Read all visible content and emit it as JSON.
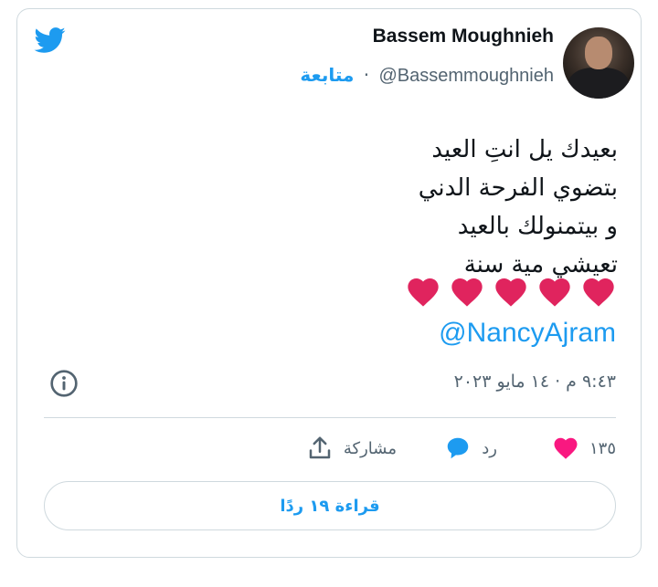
{
  "colors": {
    "accent": "#1d9bf0",
    "heart_red": "#e0245e",
    "muted": "#536471",
    "border": "#cfd9de"
  },
  "header": {
    "logo_icon": "twitter-bird-icon",
    "name": "Bassem Moughnieh",
    "handle": "@Bassemmoughnieh",
    "separator": "·",
    "follow_label": "متابعة"
  },
  "tweet": {
    "lines": [
      "بعيدك يل انتِ العيد",
      "بتضوي الفرحة الدني",
      "و بيتمنولك بالعيد",
      "تعيشي مية سنة"
    ],
    "heart_count": 5,
    "mention": "@NancyAjram"
  },
  "meta": {
    "timestamp": "٩:٤٣ م · ١٤ مايو ٢٠٢٣",
    "info_icon": "info-icon"
  },
  "actions": {
    "like_count": "١٣٥",
    "reply_label": "رد",
    "share_label": "مشاركة"
  },
  "read_replies_label": "قراءة ١٩ ردًا"
}
